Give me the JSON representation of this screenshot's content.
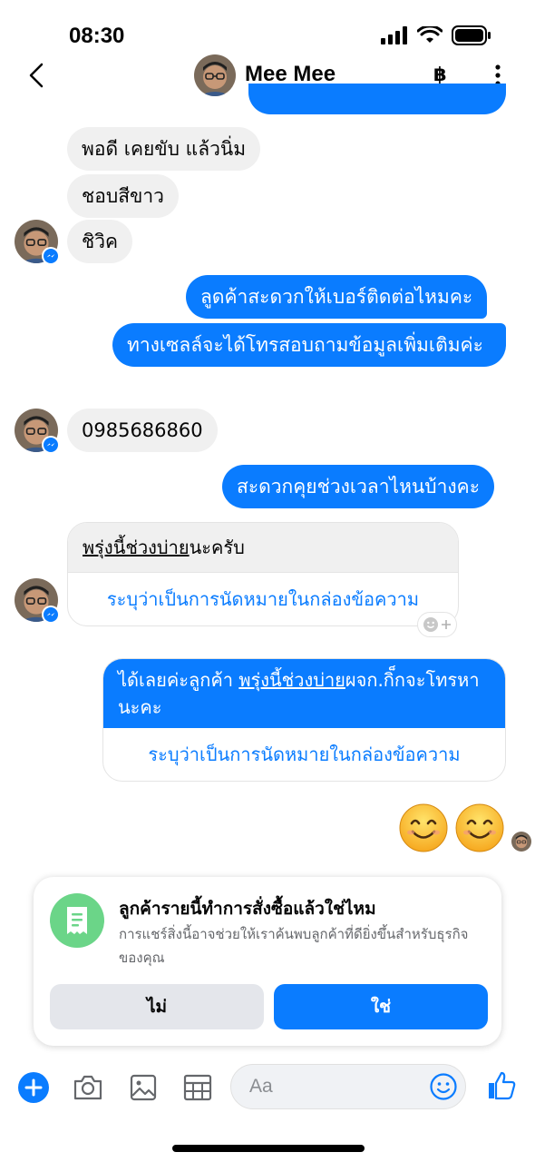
{
  "status": {
    "time": "08:30"
  },
  "header": {
    "name": "Mee Mee",
    "currency_glyph": "฿"
  },
  "messages": [
    {
      "id": "m1",
      "side": "in",
      "text": "พอดี เคยขับ แล้วนิ่ม"
    },
    {
      "id": "m2",
      "side": "in",
      "text": "ชอบสีขาว"
    },
    {
      "id": "m3",
      "side": "in",
      "text": "ชิวิค"
    },
    {
      "id": "m4",
      "side": "out",
      "text": "ลูดค้าสะดวกให้เบอร์ติดต่อไหมคะ"
    },
    {
      "id": "m5",
      "side": "out",
      "text": "ทางเซลล์จะได้โทรสอบถามข้อมูลเพิ่มเติมค่ะ"
    },
    {
      "id": "m6",
      "side": "in",
      "text": "0985686860"
    },
    {
      "id": "m7",
      "side": "out",
      "text": "สะดวกคุยช่วงเวลาไหนบ้างคะ"
    }
  ],
  "card_in": {
    "highlight": "พรุ่งนี้ช่วงบ่าย",
    "suffix": "นะครับ",
    "link": "ระบุว่าเป็นการนัดหมายในกล่องข้อความ"
  },
  "card_out": {
    "prefix": "ได้เลยค่ะลูกค้า ",
    "highlight": "พรุ่งนี้ช่วงบ่าย",
    "suffix": "ผจก.กิ็กจะโทรหานะคะ",
    "link": "ระบุว่าเป็นการนัดหมายในกล่องข้อความ"
  },
  "prompt": {
    "title": "ลูกค้ารายนี้ทำการสั่งซื้อแล้วใช่ไหม",
    "description": "การแชร์สิ่งนี้อาจช่วยให้เราค้นพบลูกค้าที่ดียิ่งขึ้นสำหรับธุรกิจของคุณ",
    "no_label": "ไม่",
    "yes_label": "ใช่"
  },
  "composer": {
    "placeholder": "Aa"
  },
  "colors": {
    "accent": "#0a7cff",
    "incoming_bg": "#f0f0f0",
    "prompt_icon_bg": "#6bd588"
  }
}
